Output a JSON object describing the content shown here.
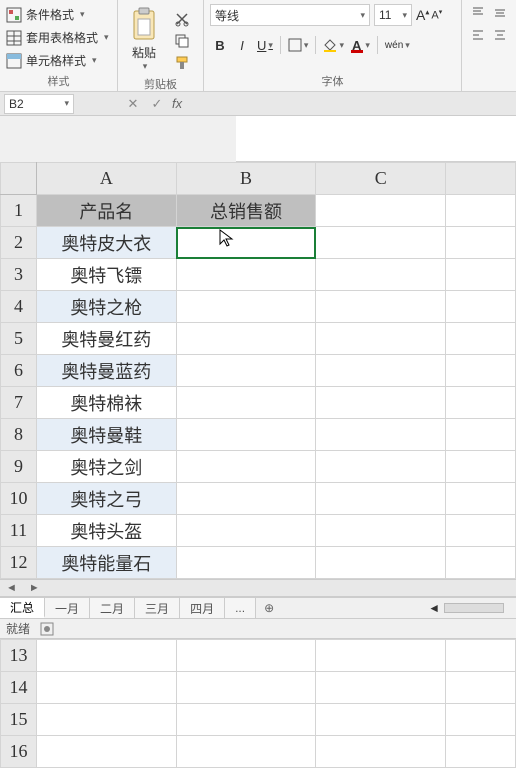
{
  "ribbon": {
    "styles": {
      "conditional": "条件格式",
      "tableFormat": "套用表格格式",
      "cellStyle": "单元格样式",
      "groupLabel": "样式"
    },
    "clipboard": {
      "paste": "粘贴",
      "groupLabel": "剪贴板"
    },
    "font": {
      "name": "等线",
      "size": "11",
      "groupLabel": "字体",
      "bold": "B",
      "italic": "I",
      "underline": "U",
      "wen": "wén"
    }
  },
  "nameBox": "B2",
  "fxLabel": "fx",
  "columns": [
    "A",
    "B",
    "C",
    ""
  ],
  "headerRow": {
    "a": "产品名",
    "b": "总销售额"
  },
  "chart_data": {
    "type": "table",
    "title": "",
    "columns": [
      "产品名",
      "总销售额"
    ],
    "rows": [
      [
        "奥特皮大衣",
        null
      ],
      [
        "奥特飞镖",
        null
      ],
      [
        "奥特之枪",
        null
      ],
      [
        "奥特曼红药",
        null
      ],
      [
        "奥特曼蓝药",
        null
      ],
      [
        "奥特棉袜",
        null
      ],
      [
        "奥特曼鞋",
        null
      ],
      [
        "奥特之剑",
        null
      ],
      [
        "奥特之弓",
        null
      ],
      [
        "奥特头盔",
        null
      ],
      [
        "奥特能量石",
        null
      ]
    ]
  },
  "rows": [
    {
      "n": 2,
      "a": "奥特皮大衣",
      "alt": true
    },
    {
      "n": 3,
      "a": "奥特飞镖",
      "alt": false
    },
    {
      "n": 4,
      "a": "奥特之枪",
      "alt": true
    },
    {
      "n": 5,
      "a": "奥特曼红药",
      "alt": false
    },
    {
      "n": 6,
      "a": "奥特曼蓝药",
      "alt": true
    },
    {
      "n": 7,
      "a": "奥特棉袜",
      "alt": false
    },
    {
      "n": 8,
      "a": "奥特曼鞋",
      "alt": true
    },
    {
      "n": 9,
      "a": "奥特之剑",
      "alt": false
    },
    {
      "n": 10,
      "a": "奥特之弓",
      "alt": true
    },
    {
      "n": 11,
      "a": "奥特头盔",
      "alt": false
    },
    {
      "n": 12,
      "a": "奥特能量石",
      "alt": true
    }
  ],
  "tabs": {
    "active": "汇总",
    "others": [
      "一月",
      "二月",
      "三月",
      "四月"
    ],
    "more": "...",
    "add": "⊕"
  },
  "status": "就绪",
  "lowerRows": [
    13,
    14,
    15,
    16
  ]
}
